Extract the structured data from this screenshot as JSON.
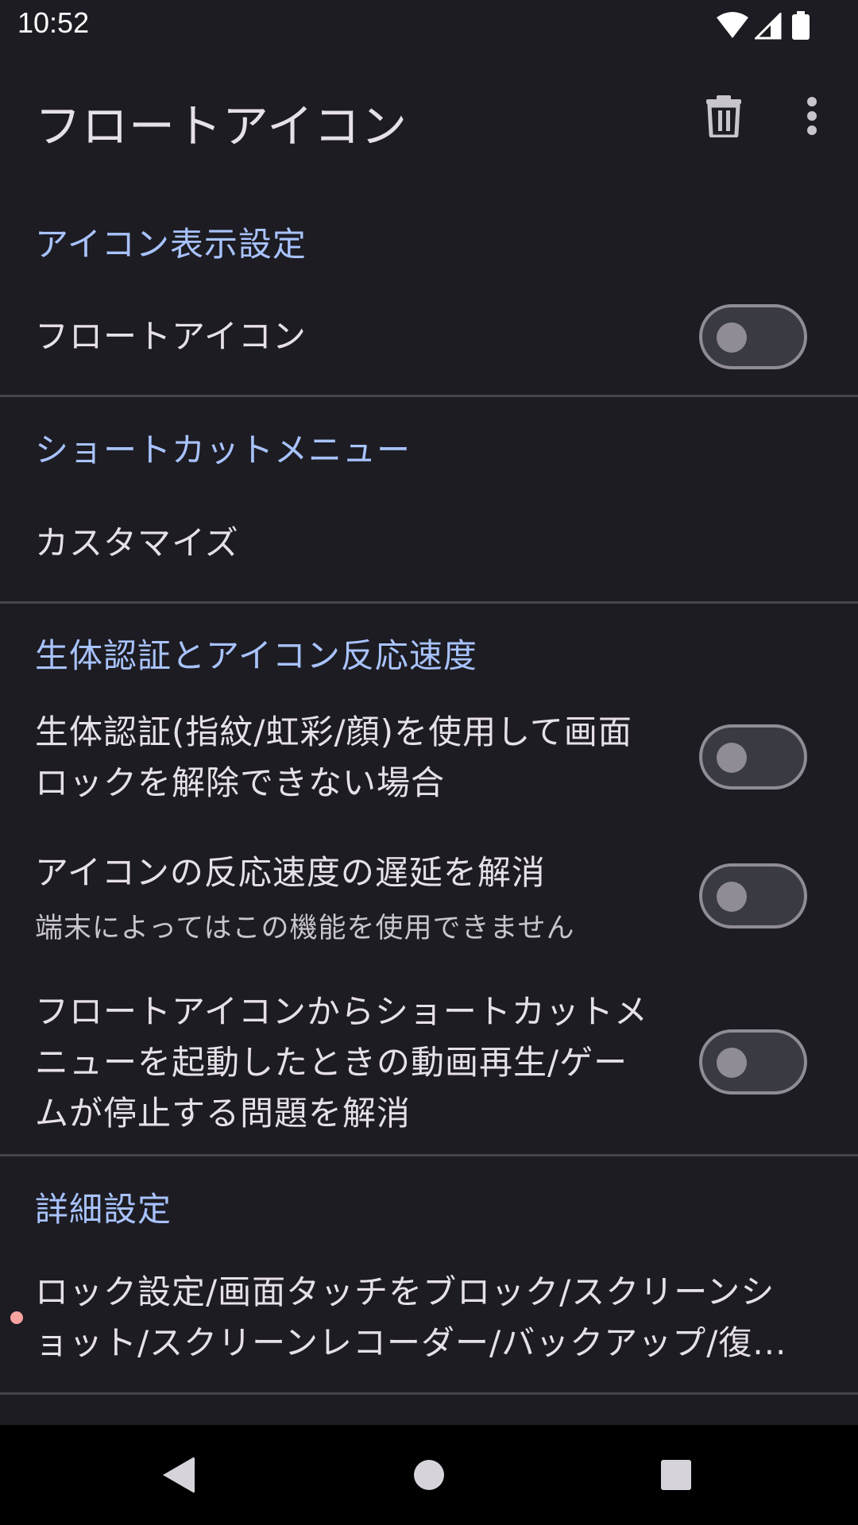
{
  "status_bar": {
    "time": "10:52",
    "icons": [
      "wifi-icon",
      "signal-icon",
      "battery-icon"
    ]
  },
  "app_bar": {
    "title": "フロートアイコン",
    "actions": [
      "delete-icon",
      "more-vert-icon"
    ]
  },
  "sections": {
    "icon_display": {
      "header": "アイコン表示設定",
      "float_icon": {
        "title": "フロートアイコン",
        "enabled": false
      }
    },
    "shortcut_menu": {
      "header": "ショートカットメニュー",
      "customize": {
        "title": "カスタマイズ"
      }
    },
    "biometric": {
      "header": "生体認証とアイコン反応速度",
      "unlock_fail": {
        "title": "生体認証(指紋/虹彩/顔)を使用して画面ロックを解除できない場合",
        "enabled": false
      },
      "delay_fix": {
        "title": "アイコンの反応速度の遅延を解消",
        "summary": "端末によってはこの機能を使用できません",
        "enabled": false
      },
      "video_fix": {
        "title": "フロートアイコンからショートカットメニューを起動したときの動画再生/ゲームが停止する問題を解消",
        "enabled": false
      }
    },
    "advanced": {
      "header": "詳細設定",
      "details": {
        "title": "ロック設定/画面タッチをブロック/スクリーンショット/スクリーンレコーダー/バックアップ/復..."
      }
    }
  },
  "nav_bar": {
    "buttons": [
      "back-icon",
      "home-icon",
      "recents-icon"
    ]
  },
  "colors": {
    "background": "#1d1c22",
    "accent": "#a8c3ff",
    "switch_off": "#8f8c96",
    "indicator_dot": "#f8a4a0"
  }
}
